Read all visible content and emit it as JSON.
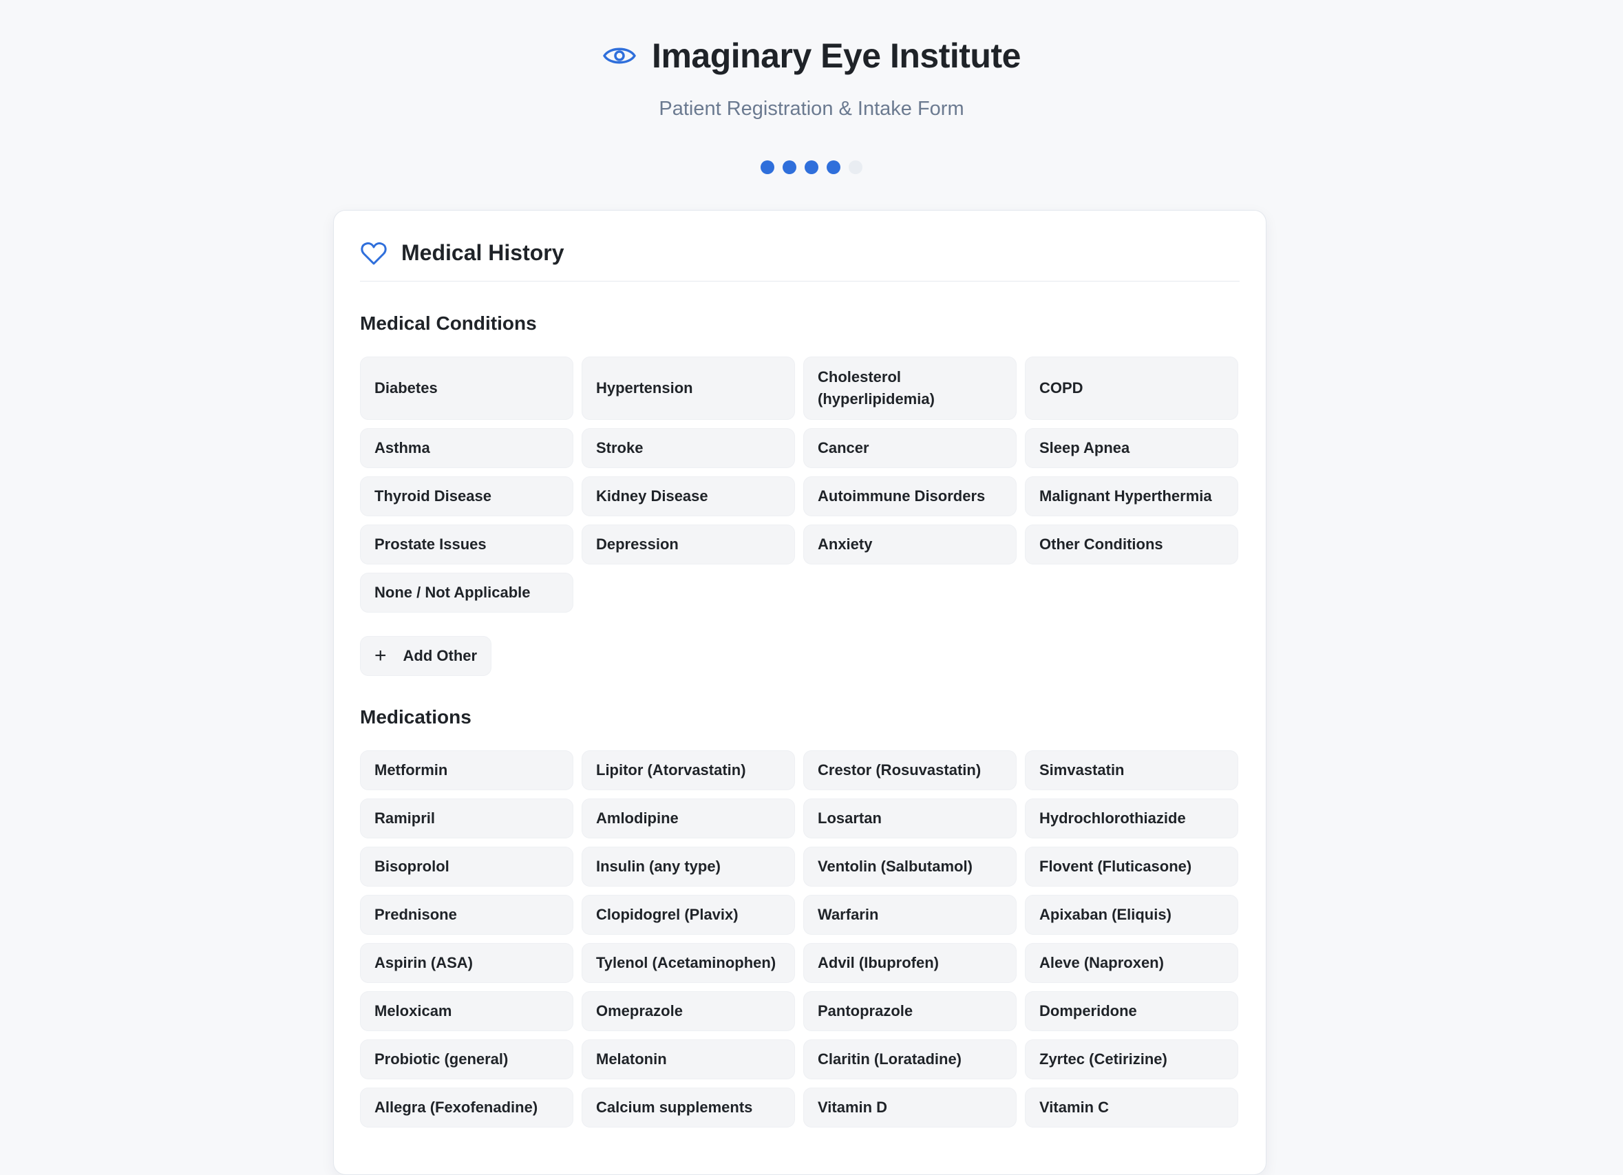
{
  "header": {
    "title": "Imaginary Eye Institute",
    "subtitle": "Patient Registration & Intake Form",
    "progress": {
      "current_step": 4,
      "total_steps": 5
    },
    "accent_color": "#2f6fdb"
  },
  "section": {
    "title": "Medical History",
    "icon": "heart-icon"
  },
  "conditions": {
    "title": "Medical Conditions",
    "items": [
      "Diabetes",
      "Hypertension",
      "Cholesterol (hyperlipidemia)",
      "COPD",
      "Asthma",
      "Stroke",
      "Cancer",
      "Sleep Apnea",
      "Thyroid Disease",
      "Kidney Disease",
      "Autoimmune Disorders",
      "Malignant Hyperthermia",
      "Prostate Issues",
      "Depression",
      "Anxiety",
      "Other Conditions",
      "None / Not Applicable"
    ],
    "add_label": "Add Other"
  },
  "medications": {
    "title": "Medications",
    "items": [
      "Metformin",
      "Lipitor (Atorvastatin)",
      "Crestor (Rosuvastatin)",
      "Simvastatin",
      "Ramipril",
      "Amlodipine",
      "Losartan",
      "Hydrochlorothiazide",
      "Bisoprolol",
      "Insulin (any type)",
      "Ventolin (Salbutamol)",
      "Flovent (Fluticasone)",
      "Prednisone",
      "Clopidogrel (Plavix)",
      "Warfarin",
      "Apixaban (Eliquis)",
      "Aspirin (ASA)",
      "Tylenol (Acetaminophen)",
      "Advil (Ibuprofen)",
      "Aleve (Naproxen)",
      "Meloxicam",
      "Omeprazole",
      "Pantoprazole",
      "Domperidone",
      "Probiotic (general)",
      "Melatonin",
      "Claritin (Loratadine)",
      "Zyrtec (Cetirizine)",
      "Allegra (Fexofenadine)",
      "Calcium supplements",
      "Vitamin D",
      "Vitamin C"
    ]
  }
}
